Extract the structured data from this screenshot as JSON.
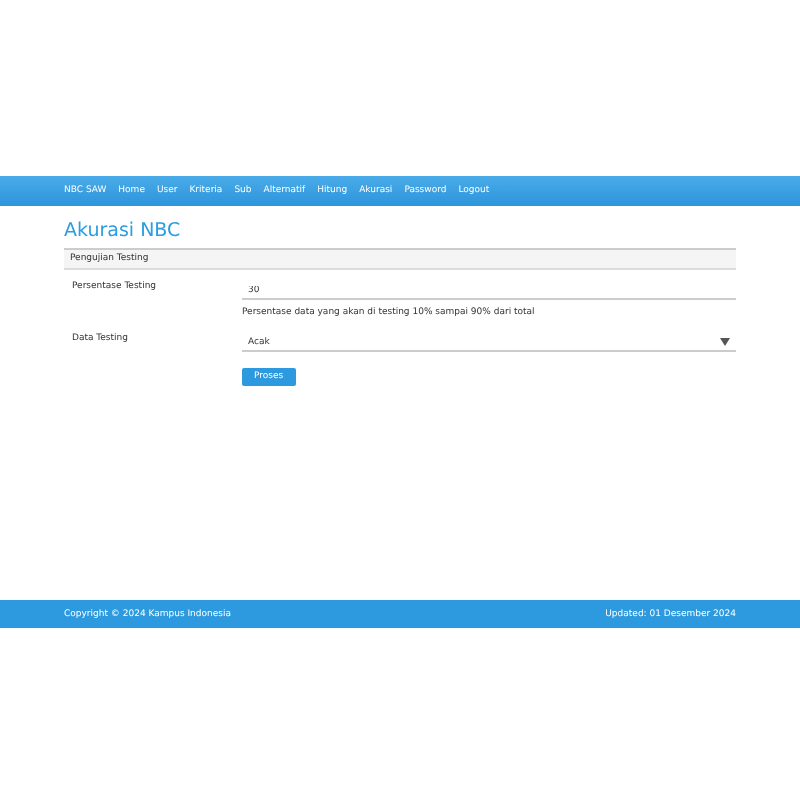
{
  "navbar": {
    "brand": "NBC SAW",
    "items": [
      {
        "label": "Home"
      },
      {
        "label": "User"
      },
      {
        "label": "Kriteria"
      },
      {
        "label": "Sub"
      },
      {
        "label": "Alternatif"
      },
      {
        "label": "Hitung"
      },
      {
        "label": "Akurasi"
      },
      {
        "label": "Password"
      },
      {
        "label": "Logout"
      }
    ]
  },
  "page_title": "Akurasi NBC",
  "panel": {
    "heading": "Pengujian Testing",
    "fields": [
      {
        "kind": "input",
        "label": "Persentase Testing",
        "value": "30",
        "help": "Persentase data yang akan di testing 10% sampai 90% dari total"
      },
      {
        "kind": "select",
        "label": "Data Testing",
        "value": "Acak"
      }
    ],
    "button": "Proses"
  },
  "footer": {
    "left": "Copyright © 2024 Kampus Indonesia",
    "right": "Updated: 01 Desember 2024"
  }
}
